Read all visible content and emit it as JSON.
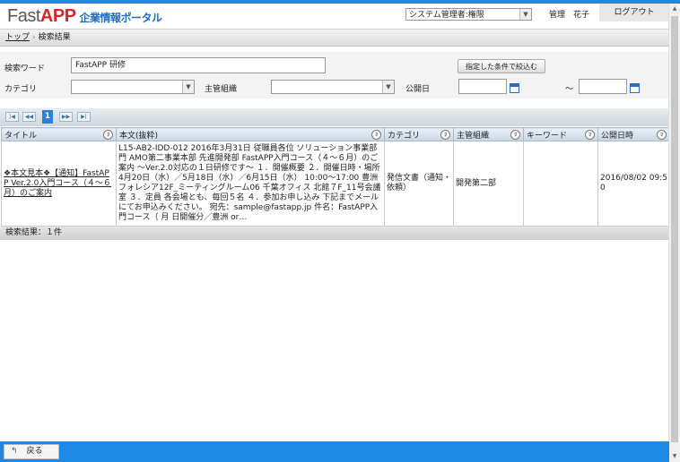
{
  "header": {
    "logo_fast": "Fast",
    "logo_app": "APP",
    "logo_sub": "企業情報ポータル",
    "role": "システム管理者:権限",
    "user": "管理　花子",
    "logout": "ログアウト"
  },
  "breadcrumb": {
    "top": "トップ",
    "sep": "›",
    "current": "検索結果"
  },
  "search": {
    "keyword_label": "検索ワード",
    "keyword_value": "FastAPP 研修",
    "filter_button": "指定した条件で絞込む",
    "category_label": "カテゴリ",
    "org_label": "主管組織",
    "date_label": "公開日",
    "date_tilde": "～"
  },
  "pager": {
    "first": "|◀",
    "prev": "◀◀",
    "current": "1",
    "next": "▶▶",
    "last": "▶|"
  },
  "table": {
    "headers": [
      "タイトル",
      "本文(抜粋)",
      "カテゴリ",
      "主管組織",
      "キーワード",
      "公開日時"
    ],
    "rows": [
      {
        "title": "❖本文見本❖【通知】FastAPP Ver.2.0入門コース（４～６月）のご案内",
        "body": "L15-AB2-IDD-012 2016年3月31日 従職員各位 ソリューション事業部門 AMO第二事業本部 先進開発部 FastAPP入門コース（４～６月）のご案内 ～Ver.2.0対応の１日研修です～ １．開催概要 ２．開催日時・場所 4月20日（水）／5月18日（水）／6月15日（水） 10:00～17:00 豊洲フォレシア12F_ミーティングルーム06 千葉オフィス 北館７F_11号会議室 ３．定員 各会場とも、毎回５名 ４．参加お申し込み 下記までメールにてお申込みください。 宛先：sample@fastapp.jp 件名：FastAPP入門コース（ 月 日開催分／豊洲 or…",
        "category": "発信文書（通知・依頼）",
        "org": "開発第二部",
        "keyword": "",
        "date": "2016/08/02 09:50"
      }
    ]
  },
  "result_count": "検索結果：１件",
  "footer": {
    "back": "戻る"
  },
  "colors": {
    "accent": "#1e88e5",
    "logo_red": "#d6262b"
  }
}
